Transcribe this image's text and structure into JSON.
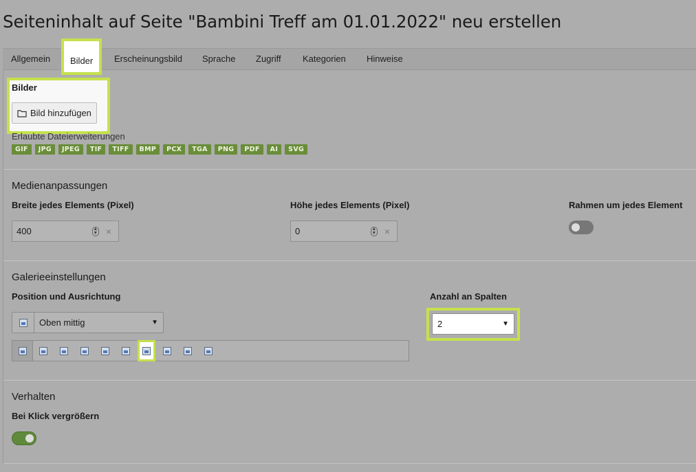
{
  "page": {
    "title": "Seiteninhalt auf Seite \"Bambini Treff am 01.01.2022\" neu erstellen"
  },
  "tabs": [
    {
      "label": "Allgemein"
    },
    {
      "label": "Bilder",
      "active": true
    },
    {
      "label": "Erscheinungsbild"
    },
    {
      "label": "Sprache"
    },
    {
      "label": "Zugriff"
    },
    {
      "label": "Kategorien"
    },
    {
      "label": "Hinweise"
    }
  ],
  "images": {
    "heading": "Bilder",
    "add_button": "Bild hinzufügen",
    "allowed_label": "Erlaubte Dateierweiterungen",
    "extensions": [
      "GIF",
      "JPG",
      "JPEG",
      "TIF",
      "TIFF",
      "BMP",
      "PCX",
      "TGA",
      "PNG",
      "PDF",
      "AI",
      "SVG"
    ]
  },
  "media": {
    "title": "Medienanpassungen",
    "width_label": "Breite jedes Elements (Pixel)",
    "width_value": "400",
    "height_label": "Höhe jedes Elements (Pixel)",
    "height_value": "0",
    "border_label": "Rahmen um jedes Element",
    "border_enabled": false
  },
  "gallery": {
    "title": "Galerieeinstellungen",
    "position_label": "Position und Ausrichtung",
    "position_value": "Oben mittig",
    "columns_label": "Anzahl an Spalten",
    "columns_value": "2",
    "position_options_count": 10,
    "selected_position_index": 6
  },
  "behavior": {
    "title": "Verhalten",
    "zoom_label": "Bei Klick vergrößern",
    "zoom_enabled": true
  },
  "colors": {
    "highlight": "#c5e14c",
    "toggle_on": "#5f8a3a",
    "badge_green": "#6a8d3a"
  }
}
